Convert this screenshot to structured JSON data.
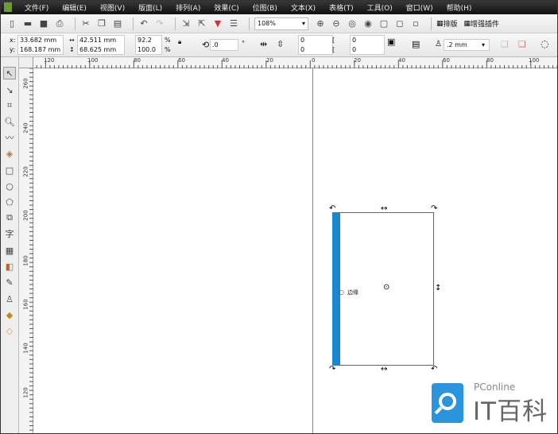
{
  "menubar": {
    "items": [
      "文件(F)",
      "编辑(E)",
      "视图(V)",
      "版面(L)",
      "排列(A)",
      "效果(C)",
      "位图(B)",
      "文本(X)",
      "表格(T)",
      "工具(O)",
      "窗口(W)",
      "帮助(H)"
    ]
  },
  "toolbar": {
    "zoom": "108%",
    "layout_label": "排版",
    "plugin_label": "增强插件"
  },
  "property_bar": {
    "x": "33.682 mm",
    "y": "168.187 mm",
    "width": "42.511 mm",
    "height": "68.625 mm",
    "scale_x": "92.2",
    "scale_y": "100.0",
    "percent": "%",
    "rotation": ".0",
    "degree": "°",
    "corner1": "0",
    "corner2": "0",
    "corner3": "0",
    "corner4": "0",
    "outline": ".2 mm",
    "x_label": "x:",
    "y_label": "y:"
  },
  "rulers": {
    "horizontal": [
      "120",
      "100",
      "80",
      "60",
      "40",
      "20",
      "0",
      "20",
      "40",
      "60",
      "80",
      "100"
    ],
    "vertical": [
      "260",
      "240",
      "220",
      "200",
      "180",
      "160",
      "140",
      "120"
    ]
  },
  "canvas": {
    "node_label": "边缘",
    "shape_fill": "#1a88d0"
  },
  "watermark": {
    "brand": "PConline",
    "name": "IT百科",
    "color": "#2a95dc"
  }
}
